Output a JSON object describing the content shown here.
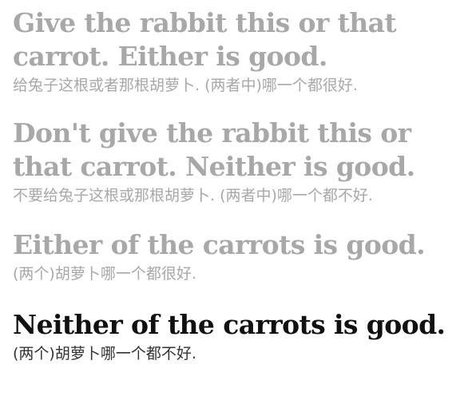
{
  "sentences": [
    {
      "en_line1": "Give the rabbit this or that",
      "en_line2": "carrot. Either is good.",
      "zh": "给兔子这根或者那根胡萝卜. (两者中)哪一个都很好."
    },
    {
      "en_line1": "Don't give the rabbit this or",
      "en_line2": "that carrot. Neither is good.",
      "zh": "不要给兔子这根或那根胡萝卜. (两者中)哪一个都不好."
    },
    {
      "en_line1": "Either of the carrots is good.",
      "zh": "(两个)胡萝卜哪一个都很好."
    },
    {
      "en_line1": "Neither of the carrots is good.",
      "zh": "(两个)胡萝卜哪一个都不好."
    }
  ],
  "colors": {
    "faded_text": "#a8a8a8",
    "active_text": "#111111",
    "active_subtext": "#333333",
    "background": "#ffffff"
  }
}
